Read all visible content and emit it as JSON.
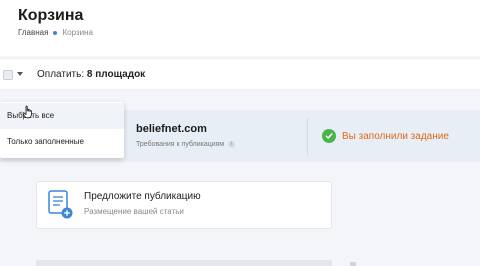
{
  "header": {
    "title": "Корзина",
    "breadcrumb": {
      "home": "Главная",
      "current": "Корзина"
    }
  },
  "toolbar": {
    "pay_prefix": "Оплатить:",
    "pay_count": "8 площадок"
  },
  "dropdown": {
    "items": [
      {
        "label": "Выбрать все"
      },
      {
        "label": "Только заполненные"
      }
    ]
  },
  "cart_item": {
    "site": "beliefnet.com",
    "requirements": "Требования к публикациям",
    "info_icon": "i",
    "status": "Вы заполнили задание"
  },
  "proposal": {
    "title": "Предложите публикацию",
    "subtitle": "Размещение вашей статьи"
  },
  "colors": {
    "accent": "#3b86d8",
    "success": "#4bb34b",
    "status_text": "#e06a1b",
    "row_bg": "#e8eef5"
  }
}
